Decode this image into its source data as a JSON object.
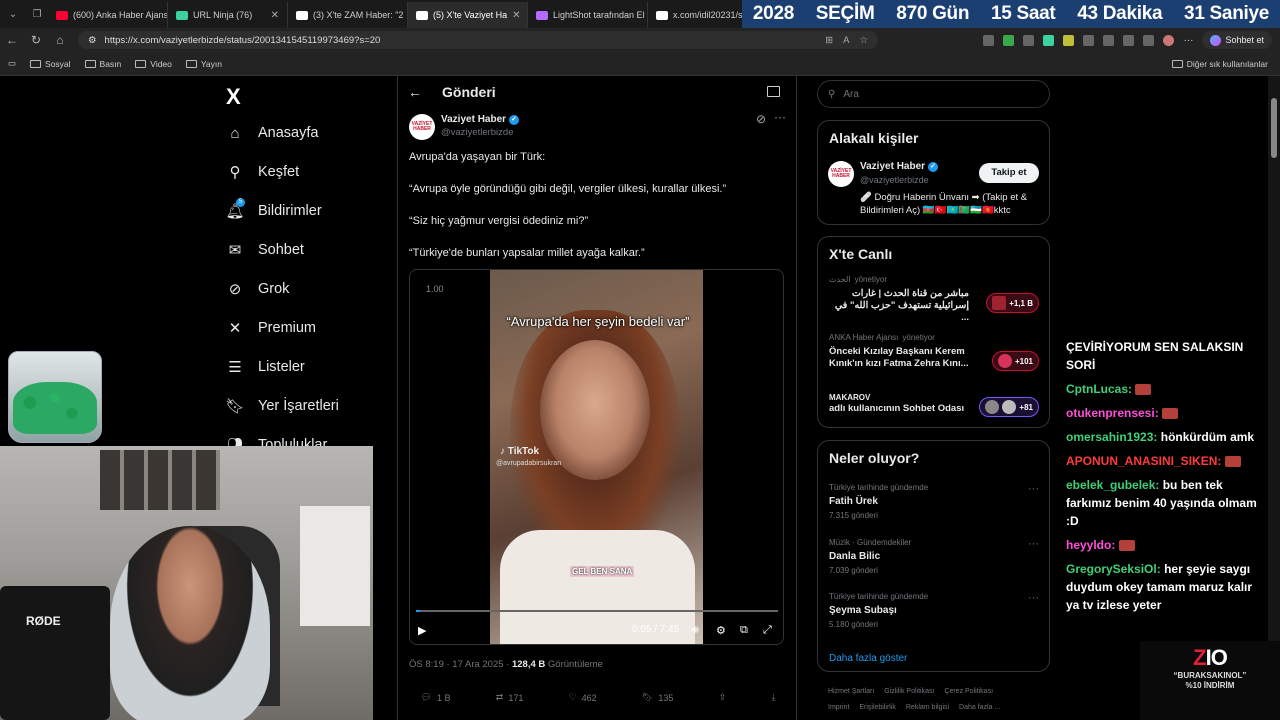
{
  "browser": {
    "tabs": [
      {
        "label": "(600) Anka Haber Ajans",
        "color": "#ff0033",
        "active": false
      },
      {
        "label": "URL Ninja (76)",
        "color": "#3ad29f",
        "active": false
      },
      {
        "label": "(3) X'te ZAM Haber: \"2",
        "color": "#ffffff",
        "active": false
      },
      {
        "label": "(5) X'te Vaziyet Ha",
        "color": "#ffffff",
        "active": true
      },
      {
        "label": "LightShot tarafından El",
        "color": "#b46bff",
        "active": false
      },
      {
        "label": "x.com/idil20231/sta",
        "color": "#ffffff",
        "active": false
      }
    ],
    "url": "https://x.com/vaziyetlerbizde/status/2001341545119973469?s=20",
    "chat_button": "Sohbet et",
    "bookmarks": [
      "Sosyal",
      "Basın",
      "Video",
      "Yayın"
    ],
    "other_bookmarks": "Diğer sık kullanılanlar"
  },
  "countdown": {
    "year": "2028",
    "label": "SEÇİM",
    "days": "870 Gün",
    "hours": "15 Saat",
    "minutes": "43 Dakika",
    "seconds": "31 Saniye"
  },
  "nav": {
    "logo": "X",
    "items": [
      "Anasayfa",
      "Keşfet",
      "Bildirimler",
      "Sohbet",
      "Grok",
      "Premium",
      "Listeler",
      "Yer İşaretleri",
      "Topluluklar"
    ],
    "notification_badge": "5"
  },
  "post": {
    "header": "Gönderi",
    "author": "Vaziyet Haber",
    "handle": "@vaziyetlerbizde",
    "avatar_text": "VAZİYET HABER",
    "lines": [
      "Avrupa'da yaşayan bir Türk:",
      "“Avrupa öyle göründüğü gibi değil, vergiler ülkesi, kurallar ülkesi.”",
      "“Siz hiç yağmur vergisi ödediniz mi?”",
      "“Türkiye'de bunları yapsalar millet ayağa kalkar.”"
    ],
    "video": {
      "speed": "1.00",
      "caption": "“Avrupa'da her şeyin bedeli var”",
      "watermark": "TikTok",
      "watermark_handle": "@avrupadabirsukran",
      "subtitle": "GEL BEN SANA",
      "time": "0:05 / 7:45",
      "progress": 0.011
    },
    "timestamp": "ÖS 8:19 · 17 Ara 2025 · ",
    "views_count": "128,4 B",
    "views_label": " Görüntüleme",
    "replies": "1 B",
    "reposts": "171",
    "likes": "462",
    "bookmarks": "135"
  },
  "sidebar": {
    "search_placeholder": "Ara",
    "related_title": "Alakalı kişiler",
    "related": {
      "name": "Vaziyet Haber",
      "handle": "@vaziyetlerbizde",
      "follow": "Takip et",
      "bio": "🩹 Doğru Haberin Ünvanı ➡ (Takip et & Bildirimleri Aç) 🇦🇿🇹🇷🇰🇿🇹🇲🇺🇿🇰🇬kktc"
    },
    "live_title": "X'te Canlı",
    "live": [
      {
        "source": "الحدث",
        "role": "yönetiyor",
        "title": "مباشر من قناة الحدث | غارات إسرائيلية تستهدف \"حزب الله\" في ...",
        "count": "+1,1 B"
      },
      {
        "source": "ANKA Haber Ajansı",
        "role": "yönetiyor",
        "title": "Önceki Kızılay Başkanı Kerem Kınık'ın kızı Fatma Zehra Kını...",
        "count": "+101"
      },
      {
        "source": "MAKAROV",
        "role": "",
        "title": "adlı kullanıcının Sohbet Odası",
        "count": "+81"
      }
    ],
    "trends_title": "Neler oluyor?",
    "trends": [
      {
        "category": "Türkiye tarihinde gündemde",
        "name": "Fatih Ürek",
        "count": "7.315 gönderi"
      },
      {
        "category": "Müzik · Gündemdekiler",
        "name": "Danla Bilic",
        "count": "7.039 gönderi"
      },
      {
        "category": "Türkiye tarihinde gündemde",
        "name": "Şeyma Subaşı",
        "count": "5.180 gönderi"
      }
    ],
    "show_more": "Daha fazla göster",
    "footer": [
      "Hizmet Şartları",
      "Gizlilik Politikası",
      "Çerez Politikası",
      "Imprint",
      "Erişilebilirlik",
      "Reklam bilgisi",
      "Daha fazla ..."
    ]
  },
  "stream": {
    "chat": [
      {
        "user": "",
        "text": "ÇEVİRİYORUM SEN SALAKSIN SORİ"
      },
      {
        "user": "CptnLucas:",
        "text": ""
      },
      {
        "user": "otukenprensesi:",
        "text": ""
      },
      {
        "user": "omersahin1923:",
        "text": "hönkürdüm amk"
      },
      {
        "user": "APONUN_ANASINI_SIKEN:",
        "text": ""
      },
      {
        "user": "ebelek_gubelek:",
        "text": "bu ben tek farkımız benim 40 yaşında olmam :D"
      },
      {
        "user": "heyyldo:",
        "text": ""
      },
      {
        "user": "GregorySeksiOl:",
        "text": "her şeyie saygı duydum okey tamam maruz kalır ya tv izlese yeter"
      }
    ],
    "chat_colors": [
      "#ffffff",
      "#3fd07a",
      "#ff4fd8",
      "#3fd07a",
      "#ff3b3b",
      "#3fd07a",
      "#ff4fd8",
      "#3fd07a"
    ],
    "mic_brand": "RØDE",
    "promo_logo_a": "Z",
    "promo_logo_b": "IO",
    "promo_line1": "“BURAKSAKINOL”",
    "promo_line2": "%10 İNDİRİM"
  }
}
